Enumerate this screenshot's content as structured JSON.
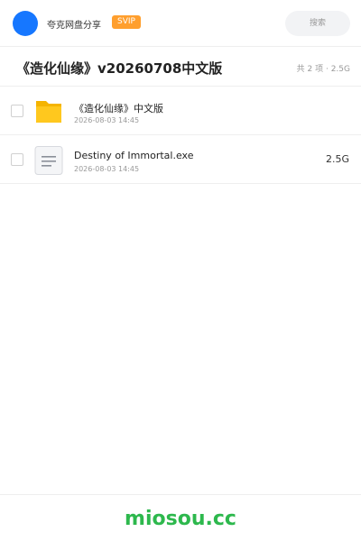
{
  "header": {
    "app_name": "夸克网盘分享",
    "badge": "SVIP",
    "search_placeholder": "搜索"
  },
  "share": {
    "title": "《造化仙缘》v20260708中文版",
    "summary": "共 2 项 · 2.5G"
  },
  "files": [
    {
      "icon": "folder-icon",
      "name": "《造化仙缘》中文版",
      "date": "2026-08-03 14:45",
      "size": ""
    },
    {
      "icon": "document-icon",
      "name": "Destiny of Immortal.exe",
      "date": "2026-08-03 14:45",
      "size": "2.5G"
    }
  ],
  "footer": {
    "watermark": "miosou.cc"
  },
  "colors": {
    "avatar": "#1677ff",
    "badge": "#ff9f2e",
    "folder": "#ffc81e",
    "watermark": "#2db84d"
  }
}
